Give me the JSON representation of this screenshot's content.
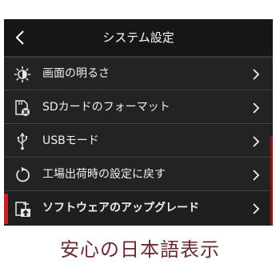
{
  "header": {
    "title": "システム設定"
  },
  "menu": {
    "items": [
      {
        "label": "画面の明るさ",
        "icon": "brightness-icon"
      },
      {
        "label": "SDカードのフォーマット",
        "icon": "sd-card-format-icon"
      },
      {
        "label": "USBモード",
        "icon": "usb-icon"
      },
      {
        "label": "工場出荷時の設定に戻す",
        "icon": "reset-icon"
      },
      {
        "label": "ソフトウェアのアップグレード",
        "icon": "upgrade-icon"
      }
    ]
  },
  "caption": "安心の日本語表示",
  "colors": {
    "accent": "#c81e2a",
    "screen_bg": "#1c1c1c",
    "caption": "#6a2a32"
  }
}
